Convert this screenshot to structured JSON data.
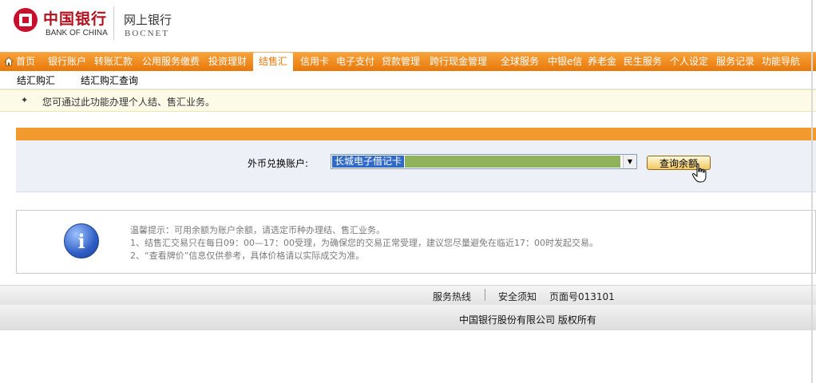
{
  "header": {
    "bank_name_cn": "中国银行",
    "bank_name_en": "BANK OF CHINA",
    "site_name_cn": "网上银行",
    "site_name_en": "BOCNET",
    "brand_color": "#c8102e"
  },
  "nav": {
    "accent_color": "#f29a2e",
    "items": [
      {
        "label": "首页"
      },
      {
        "label": "银行账户"
      },
      {
        "label": "转账汇款"
      },
      {
        "label": "公用服务缴费"
      },
      {
        "label": "投资理财"
      },
      {
        "label": "结售汇",
        "active": true
      },
      {
        "label": "信用卡"
      },
      {
        "label": "电子支付"
      },
      {
        "label": "贷款管理"
      },
      {
        "label": "跨行现金管理"
      },
      {
        "label": "全球服务"
      },
      {
        "label": "中银e信"
      },
      {
        "label": "养老金"
      },
      {
        "label": "民生服务"
      },
      {
        "label": "个人设定"
      },
      {
        "label": "服务记录"
      },
      {
        "label": "功能导航"
      }
    ]
  },
  "subnav": {
    "items": [
      {
        "label": "结汇购汇"
      },
      {
        "label": "结汇购汇查询"
      }
    ]
  },
  "info": {
    "text": "您可通过此功能办理个人结、售汇业务。"
  },
  "form": {
    "account_label": "外币兑换账户:",
    "account_value": "长城电子借记卡",
    "query_button": "查询余额"
  },
  "tips": {
    "lines": [
      "温馨提示：可用余额为账户余额，请选定币种办理结、售汇业务。",
      "1、结售汇交易只在每日09：00—17：00受理，为确保您的交易正常受理，建议您尽量避免在临近17：00时发起交易。",
      "2、“查看牌价”信息仅供参考，具体价格请以实际成交为准。"
    ]
  },
  "footer": {
    "hotline": "服务热线",
    "notice": "安全须知",
    "page_number": "页面号013101",
    "copyright": "中国银行股份有限公司 版权所有"
  }
}
